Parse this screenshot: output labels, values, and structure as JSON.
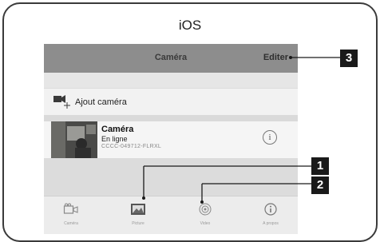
{
  "os_label": "iOS",
  "navbar": {
    "title": "Caméra",
    "edit_label": "Editer"
  },
  "add_camera": {
    "label": "Ajout caméra",
    "icon": "camera-add-icon"
  },
  "camera": {
    "name": "Caméra",
    "status": "En ligne",
    "id": "CCCC-049712-FLRXL",
    "info_icon": "info-icon",
    "info_glyph": "i"
  },
  "tabs": [
    {
      "label": "Caméra",
      "icon": "camera-tab-icon"
    },
    {
      "label": "Picture",
      "icon": "picture-tab-icon"
    },
    {
      "label": "Video",
      "icon": "video-tab-icon"
    },
    {
      "label": "A propos",
      "icon": "about-tab-icon"
    }
  ],
  "callouts": [
    "1",
    "2",
    "3"
  ],
  "colors": {
    "navbar": "#8d8d8d",
    "callout": "#1a1a1a"
  }
}
